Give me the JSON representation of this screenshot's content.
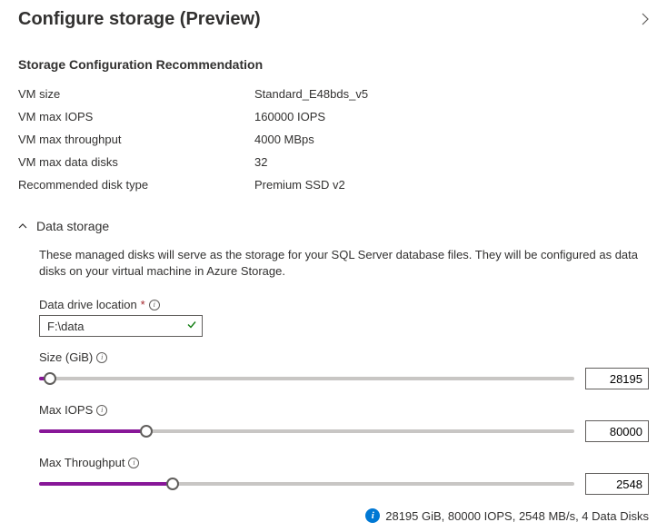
{
  "header": {
    "title": "Configure storage (Preview)"
  },
  "recommendation": {
    "heading": "Storage Configuration Recommendation",
    "rows": [
      {
        "label": "VM size",
        "value": "Standard_E48bds_v5"
      },
      {
        "label": "VM max IOPS",
        "value": "160000 IOPS"
      },
      {
        "label": "VM max throughput",
        "value": "4000 MBps"
      },
      {
        "label": "VM max data disks",
        "value": "32"
      },
      {
        "label": "Recommended disk type",
        "value": "Premium SSD v2"
      }
    ]
  },
  "dataStorage": {
    "title": "Data storage",
    "description": "These managed disks will serve as the storage for your SQL Server database files. They will be configured as data disks on your virtual machine in Azure Storage.",
    "driveLocation": {
      "label": "Data drive location",
      "value": "F:\\data"
    },
    "sliders": {
      "size": {
        "label": "Size (GiB)",
        "value": "28195",
        "fillPercent": 2
      },
      "iops": {
        "label": "Max IOPS",
        "value": "80000",
        "fillPercent": 20
      },
      "throughput": {
        "label": "Max Throughput",
        "value": "2548",
        "fillPercent": 25
      }
    },
    "summary": "28195 GiB, 80000 IOPS, 2548 MB/s, 4 Data Disks"
  }
}
